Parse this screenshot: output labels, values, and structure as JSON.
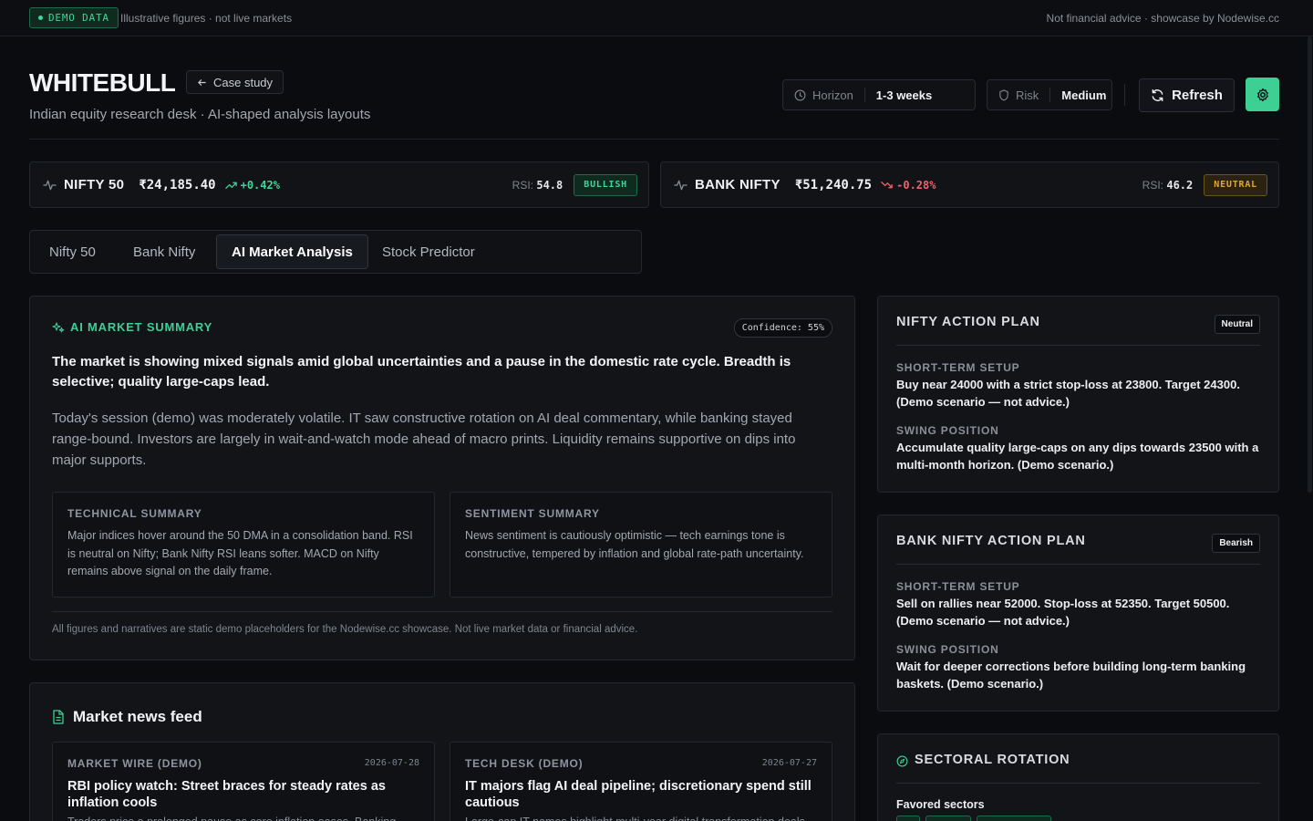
{
  "topbar": {
    "demo_badge": "DEMO DATA",
    "note_left": "Illustrative figures · not live markets",
    "note_right": "Not financial advice · showcase by Nodewise.cc"
  },
  "header": {
    "brand": "WHITEBULL",
    "case_study": "Case study",
    "subtitle": "Indian equity research desk · AI-shaped analysis layouts",
    "horizon_label": "Horizon",
    "horizon_value": "1-3 weeks",
    "risk_label": "Risk",
    "risk_value": "Medium",
    "refresh": "Refresh"
  },
  "tickers": [
    {
      "name": "NIFTY 50",
      "price": "₹24,185.40",
      "change": "+0.42%",
      "rsi_label": "RSI:",
      "rsi": "54.8",
      "signal": "BULLISH"
    },
    {
      "name": "BANK NIFTY",
      "price": "₹51,240.75",
      "change": "-0.28%",
      "rsi_label": "RSI:",
      "rsi": "46.2",
      "signal": "NEUTRAL"
    }
  ],
  "tabs": [
    "Nifty 50",
    "Bank Nifty",
    "AI Market Analysis",
    "Stock Predictor"
  ],
  "summary": {
    "title": "AI MARKET SUMMARY",
    "confidence": "Confidence: 55%",
    "lead": "The market is showing mixed signals amid global uncertainties and a pause in the domestic rate cycle. Breadth is selective; quality large-caps lead.",
    "body": "Today's session (demo) was moderately volatile. IT saw constructive rotation on AI deal commentary, while banking stayed range-bound. Investors are largely in wait-and-watch mode ahead of macro prints. Liquidity remains supportive on dips into major supports.",
    "technical_title": "TECHNICAL SUMMARY",
    "technical_text": "Major indices hover around the 50 DMA in a consolidation band. RSI is neutral on Nifty; Bank Nifty RSI leans softer. MACD on Nifty remains above signal on the daily frame.",
    "sentiment_title": "SENTIMENT SUMMARY",
    "sentiment_text": "News sentiment is cautiously optimistic — tech earnings tone is constructive, tempered by inflation and global rate-path uncertainty.",
    "disclaimer": "All figures and narratives are static demo placeholders for the Nodewise.cc showcase. Not live market data or financial advice."
  },
  "news": {
    "title": "Market news feed",
    "items": [
      {
        "source": "MARKET WIRE (DEMO)",
        "date": "2026-07-28",
        "headline": "RBI policy watch: Street braces for steady rates as inflation cools",
        "excerpt": "Traders price a prolonged pause as core inflation eases. Banking"
      },
      {
        "source": "TECH DESK (DEMO)",
        "date": "2026-07-27",
        "headline": "IT majors flag AI deal pipeline; discretionary spend still cautious",
        "excerpt": "Large-cap IT names highlight multi-year digital transformation deals"
      }
    ]
  },
  "nifty_plan": {
    "title": "NIFTY ACTION PLAN",
    "tag": "Neutral",
    "short_label": "SHORT-TERM SETUP",
    "short_text": "Buy near 24000 with a strict stop-loss at 23800. Target 24300. (Demo scenario — not advice.)",
    "swing_label": "SWING POSITION",
    "swing_text": "Accumulate quality large-caps on any dips towards 23500 with a multi-month horizon. (Demo scenario.)"
  },
  "bank_plan": {
    "title": "BANK NIFTY ACTION PLAN",
    "tag": "Bearish",
    "short_label": "SHORT-TERM SETUP",
    "short_text": "Sell on rallies near 52000. Stop-loss at 52350. Target 50500. (Demo scenario — not advice.)",
    "swing_label": "SWING POSITION",
    "swing_text": "Wait for deeper corrections before building long-term banking baskets. (Demo scenario.)"
  },
  "sectoral": {
    "title": "SECTORAL ROTATION",
    "favored_label": "Favored sectors"
  },
  "colors": {
    "accent": "#3ecf95",
    "up": "#3fd59a",
    "down": "#f0616b",
    "neutral": "#e3a53a"
  }
}
